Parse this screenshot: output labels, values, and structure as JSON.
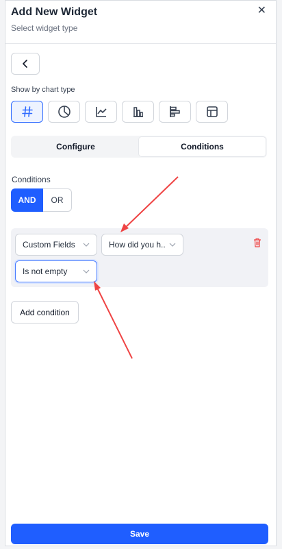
{
  "header": {
    "title": "Add New Widget",
    "subtitle": "Select widget type",
    "close_icon": "close-icon"
  },
  "back": {
    "icon": "chevron-left-icon"
  },
  "chart_types": {
    "label": "Show by chart type",
    "items": [
      {
        "icon": "hash-icon",
        "active": true
      },
      {
        "icon": "pie-chart-icon",
        "active": false
      },
      {
        "icon": "line-chart-icon",
        "active": false
      },
      {
        "icon": "bar-chart-icon",
        "active": false
      },
      {
        "icon": "horizontal-bar-chart-icon",
        "active": false
      },
      {
        "icon": "table-icon",
        "active": false
      }
    ]
  },
  "tabs": [
    {
      "label": "Configure",
      "active": false
    },
    {
      "label": "Conditions",
      "active": true
    }
  ],
  "conditions": {
    "label": "Conditions",
    "logic": {
      "and": "AND",
      "or": "OR",
      "selected": "AND"
    },
    "row": {
      "field_type": "Custom Fields",
      "field": "How did you h...",
      "operator": "Is not empty"
    },
    "add_button": "Add condition"
  },
  "footer": {
    "save": "Save"
  },
  "colors": {
    "primary": "#1f5eff",
    "delete": "#ef4444",
    "annotation_arrow": "#ef4444"
  }
}
